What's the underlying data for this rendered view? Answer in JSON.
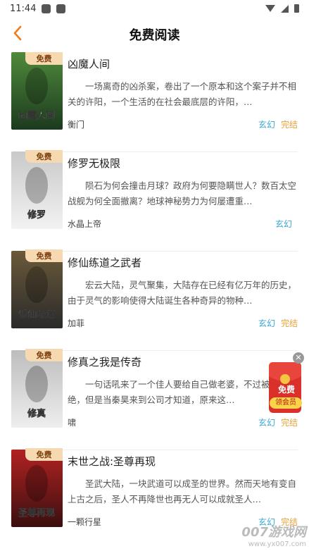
{
  "status": {
    "time": "11:44"
  },
  "header": {
    "title": "免费阅读"
  },
  "books": [
    {
      "title": "凶魔人间",
      "desc": "一场离奇的凶杀案，卷出了一个原本和这个案子并不相关的许阳，一个生活的在社会最底层的许阳，…",
      "author": "衡门",
      "genre": "玄幻",
      "status": "完结",
      "free": "免费",
      "cover_text": "凶魔人间",
      "cover_colors": [
        "#1c3a1e",
        "#4f8a3c"
      ]
    },
    {
      "title": "修罗无极限",
      "desc": "陨石为何会撞击月球？政府为何要隐瞒世人？数百太空战舰为何全面撤离？地球神秘势力为何屡遭重…",
      "author": "水晶上帝",
      "genre": "玄幻",
      "status": "",
      "free": "免费",
      "cover_text": "修罗",
      "cover_colors": [
        "#f2f2f2",
        "#c9c9c9"
      ]
    },
    {
      "title": "修仙练道之武者",
      "desc": "宏云大陆，灵气聚集，大陆存在已经有亿万年的历史，由于灵气的影响使得大陆诞生各种奇异的物种…",
      "author": "加菲",
      "genre": "玄幻",
      "status": "完结",
      "free": "免费",
      "cover_text": "修仙练道",
      "cover_colors": [
        "#2a2a2a",
        "#6b5a3a"
      ]
    },
    {
      "title": "修真之我是传奇",
      "desc": "一句话吼来了一个佳人要给自己做老婆，不过被秦昊拒绝，但是当秦昊来到公司才知道，原来这…",
      "author": "啸",
      "genre": "玄幻",
      "status": "完结",
      "free": "免费",
      "cover_text": "修真",
      "cover_colors": [
        "#eeeeee",
        "#bdbdbd"
      ]
    },
    {
      "title": "末世之战:圣尊再现",
      "desc": "圣武大陆，一块武道可以成圣的世界。然而天地有变自上古之后，圣人不再降世也再无人可以成就圣人…",
      "author": "一颗行星",
      "genre": "玄幻",
      "status": "完结",
      "free": "免费",
      "cover_text": "圣尊再现",
      "cover_colors": [
        "#3a0f0f",
        "#b22222"
      ]
    }
  ],
  "ad": {
    "text": "免费",
    "vip": "领会员"
  },
  "watermark": {
    "big": "007游戏网",
    "small": "www.yx007.com"
  }
}
